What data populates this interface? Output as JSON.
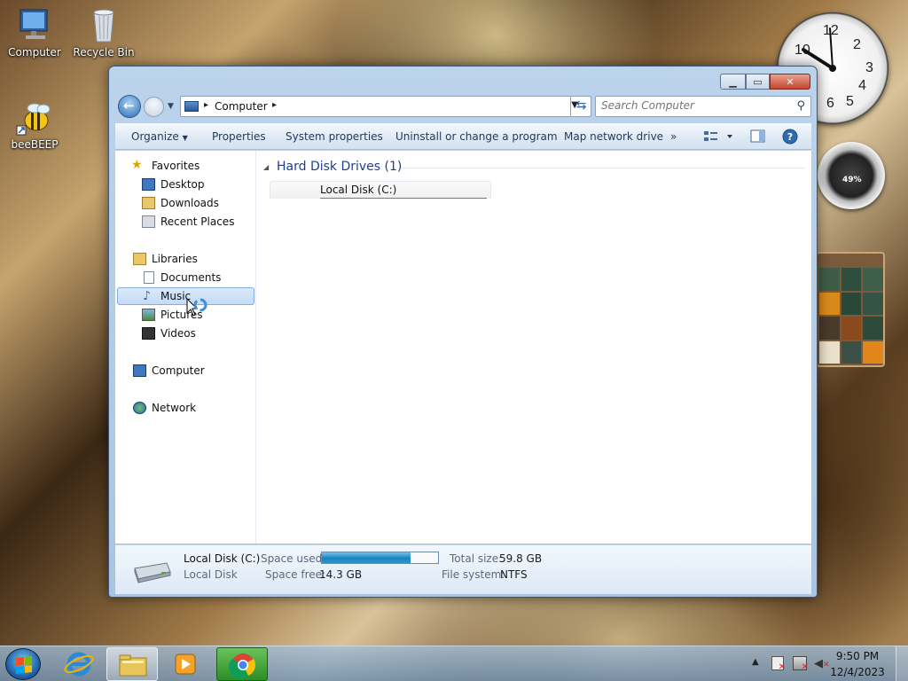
{
  "desktop": {
    "icons": [
      {
        "label": "Computer"
      },
      {
        "label": "Recycle Bin"
      },
      {
        "label": "beeBEEP"
      }
    ],
    "gadgets": {
      "clock_numbers": [
        "10",
        "12",
        "2",
        "3",
        "4",
        "5",
        "6"
      ],
      "meter_percent": "49%"
    }
  },
  "window": {
    "caption_buttons": {
      "minimize": "▁",
      "maximize": "▭",
      "close": "✕"
    },
    "address": {
      "crumb": "Computer"
    },
    "search": {
      "placeholder": "Search Computer"
    },
    "toolbar": {
      "organize": "Organize",
      "properties": "Properties",
      "system_properties": "System properties",
      "uninstall": "Uninstall or change a program",
      "map_drive": "Map network drive",
      "more": "»"
    },
    "nav": {
      "favorites": "Favorites",
      "desktop": "Desktop",
      "downloads": "Downloads",
      "recent_places": "Recent Places",
      "libraries": "Libraries",
      "documents": "Documents",
      "music": "Music",
      "pictures": "Pictures",
      "videos": "Videos",
      "computer": "Computer",
      "network": "Network"
    },
    "content": {
      "group_header": "Hard Disk Drives (1)",
      "drives": [
        {
          "name": "Local Disk (C:)",
          "used_fraction": 0.76
        }
      ]
    },
    "details": {
      "name": "Local Disk (C:)",
      "type": "Local Disk",
      "space_used_label": "Space used:",
      "space_free_label": "Space free:",
      "space_free_value": "14.3 GB",
      "total_size_label": "Total size:",
      "total_size_value": "59.8 GB",
      "filesystem_label": "File system:",
      "filesystem_value": "NTFS",
      "used_fraction": 0.76
    }
  },
  "taskbar": {
    "time": "9:50 PM",
    "date": "12/4/2023"
  },
  "colors": {
    "accent": "#1e3f8f",
    "selection": "#c4dcf6",
    "progress": "#2a8fcb"
  }
}
